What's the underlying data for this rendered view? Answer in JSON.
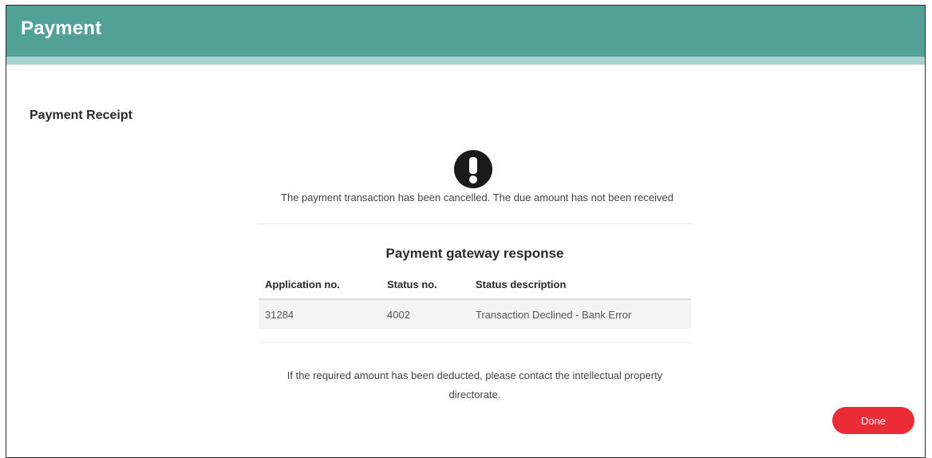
{
  "header": {
    "title": "Payment"
  },
  "receipt": {
    "section_title": "Payment Receipt",
    "status_icon": "exclamation-circle-icon",
    "message": "The payment transaction has been cancelled. The due amount has not been received"
  },
  "gateway": {
    "title": "Payment gateway response",
    "columns": [
      "Application no.",
      "Status no.",
      "Status description"
    ],
    "rows": [
      [
        "31284",
        "4002",
        "Transaction Declined - Bank Error"
      ]
    ]
  },
  "note": {
    "line1": "If the required amount has been deducted, please contact the intellectual property",
    "line2": "directorate."
  },
  "actions": {
    "done_label": "Done"
  },
  "colors": {
    "header_bg": "#52a197",
    "header_strip": "#a7d3cd",
    "done_button": "#eb2b36",
    "icon": "#1a1a1a"
  }
}
